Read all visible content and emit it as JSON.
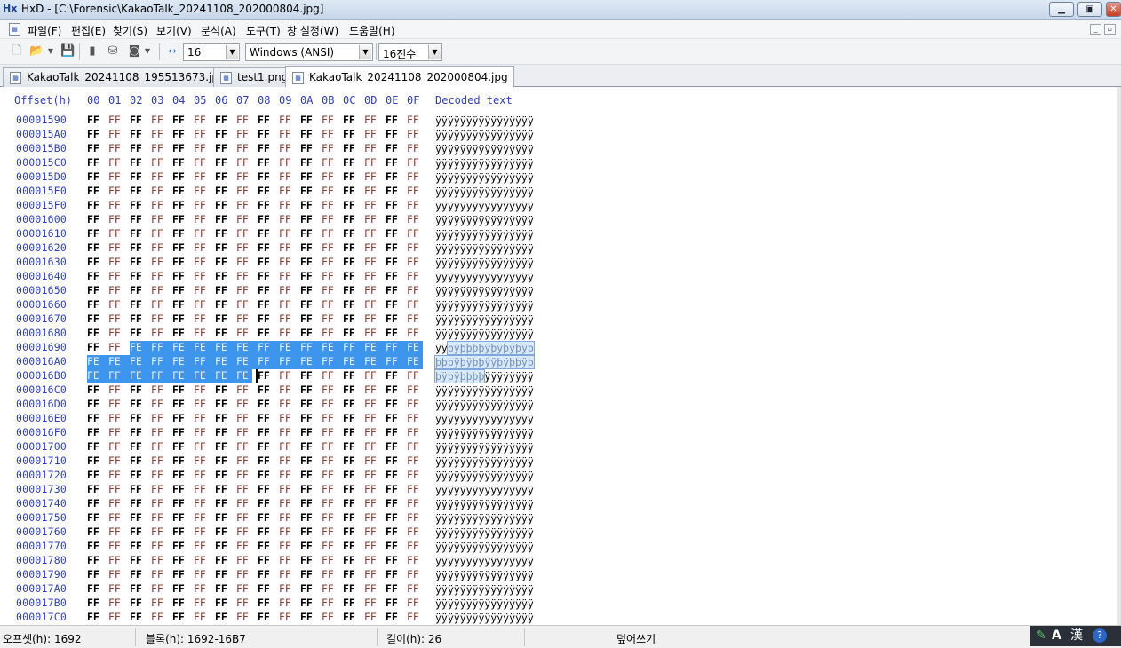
{
  "window": {
    "app_icon_text": "Hx",
    "title": "HxD - [C:\\Forensic\\KakaoTalk_20241108_202000804.jpg]",
    "min_label": "▁",
    "max_label": "▣",
    "close_label": "✕"
  },
  "menu": {
    "items": [
      "파일(F)",
      "편집(E)",
      "찾기(S)",
      "보기(V)",
      "분석(A)",
      "도구(T)",
      "창 설정(W)",
      "도움말(H)"
    ],
    "mdi_min": "_",
    "mdi_restore": "▫"
  },
  "toolbar": {
    "bytes_per_row": "16",
    "charset": "Windows (ANSI)",
    "offset_base": "16진수"
  },
  "tabs": [
    {
      "label": "KakaoTalk_20241108_195513673.jpg",
      "active": false
    },
    {
      "label": "test1.png",
      "active": false
    },
    {
      "label": "KakaoTalk_20241108_202000804.jpg",
      "active": true
    }
  ],
  "hex": {
    "offset_header": "Offset(h)",
    "columns": [
      "00",
      "01",
      "02",
      "03",
      "04",
      "05",
      "06",
      "07",
      "08",
      "09",
      "0A",
      "0B",
      "0C",
      "0D",
      "0E",
      "0F"
    ],
    "decoded_header": "Decoded text",
    "rows": [
      {
        "offset": "00001590",
        "bytes": [
          "FF",
          "FF",
          "FF",
          "FF",
          "FF",
          "FF",
          "FF",
          "FF",
          "FF",
          "FF",
          "FF",
          "FF",
          "FF",
          "FF",
          "FF",
          "FF"
        ],
        "text": "ÿÿÿÿÿÿÿÿÿÿÿÿÿÿÿÿ"
      },
      {
        "offset": "000015A0",
        "bytes": [
          "FF",
          "FF",
          "FF",
          "FF",
          "FF",
          "FF",
          "FF",
          "FF",
          "FF",
          "FF",
          "FF",
          "FF",
          "FF",
          "FF",
          "FF",
          "FF"
        ],
        "text": "ÿÿÿÿÿÿÿÿÿÿÿÿÿÿÿÿ"
      },
      {
        "offset": "000015B0",
        "bytes": [
          "FF",
          "FF",
          "FF",
          "FF",
          "FF",
          "FF",
          "FF",
          "FF",
          "FF",
          "FF",
          "FF",
          "FF",
          "FF",
          "FF",
          "FF",
          "FF"
        ],
        "text": "ÿÿÿÿÿÿÿÿÿÿÿÿÿÿÿÿ"
      },
      {
        "offset": "000015C0",
        "bytes": [
          "FF",
          "FF",
          "FF",
          "FF",
          "FF",
          "FF",
          "FF",
          "FF",
          "FF",
          "FF",
          "FF",
          "FF",
          "FF",
          "FF",
          "FF",
          "FF"
        ],
        "text": "ÿÿÿÿÿÿÿÿÿÿÿÿÿÿÿÿ"
      },
      {
        "offset": "000015D0",
        "bytes": [
          "FF",
          "FF",
          "FF",
          "FF",
          "FF",
          "FF",
          "FF",
          "FF",
          "FF",
          "FF",
          "FF",
          "FF",
          "FF",
          "FF",
          "FF",
          "FF"
        ],
        "text": "ÿÿÿÿÿÿÿÿÿÿÿÿÿÿÿÿ"
      },
      {
        "offset": "000015E0",
        "bytes": [
          "FF",
          "FF",
          "FF",
          "FF",
          "FF",
          "FF",
          "FF",
          "FF",
          "FF",
          "FF",
          "FF",
          "FF",
          "FF",
          "FF",
          "FF",
          "FF"
        ],
        "text": "ÿÿÿÿÿÿÿÿÿÿÿÿÿÿÿÿ"
      },
      {
        "offset": "000015F0",
        "bytes": [
          "FF",
          "FF",
          "FF",
          "FF",
          "FF",
          "FF",
          "FF",
          "FF",
          "FF",
          "FF",
          "FF",
          "FF",
          "FF",
          "FF",
          "FF",
          "FF"
        ],
        "text": "ÿÿÿÿÿÿÿÿÿÿÿÿÿÿÿÿ"
      },
      {
        "offset": "00001600",
        "bytes": [
          "FF",
          "FF",
          "FF",
          "FF",
          "FF",
          "FF",
          "FF",
          "FF",
          "FF",
          "FF",
          "FF",
          "FF",
          "FF",
          "FF",
          "FF",
          "FF"
        ],
        "text": "ÿÿÿÿÿÿÿÿÿÿÿÿÿÿÿÿ"
      },
      {
        "offset": "00001610",
        "bytes": [
          "FF",
          "FF",
          "FF",
          "FF",
          "FF",
          "FF",
          "FF",
          "FF",
          "FF",
          "FF",
          "FF",
          "FF",
          "FF",
          "FF",
          "FF",
          "FF"
        ],
        "text": "ÿÿÿÿÿÿÿÿÿÿÿÿÿÿÿÿ"
      },
      {
        "offset": "00001620",
        "bytes": [
          "FF",
          "FF",
          "FF",
          "FF",
          "FF",
          "FF",
          "FF",
          "FF",
          "FF",
          "FF",
          "FF",
          "FF",
          "FF",
          "FF",
          "FF",
          "FF"
        ],
        "text": "ÿÿÿÿÿÿÿÿÿÿÿÿÿÿÿÿ"
      },
      {
        "offset": "00001630",
        "bytes": [
          "FF",
          "FF",
          "FF",
          "FF",
          "FF",
          "FF",
          "FF",
          "FF",
          "FF",
          "FF",
          "FF",
          "FF",
          "FF",
          "FF",
          "FF",
          "FF"
        ],
        "text": "ÿÿÿÿÿÿÿÿÿÿÿÿÿÿÿÿ"
      },
      {
        "offset": "00001640",
        "bytes": [
          "FF",
          "FF",
          "FF",
          "FF",
          "FF",
          "FF",
          "FF",
          "FF",
          "FF",
          "FF",
          "FF",
          "FF",
          "FF",
          "FF",
          "FF",
          "FF"
        ],
        "text": "ÿÿÿÿÿÿÿÿÿÿÿÿÿÿÿÿ"
      },
      {
        "offset": "00001650",
        "bytes": [
          "FF",
          "FF",
          "FF",
          "FF",
          "FF",
          "FF",
          "FF",
          "FF",
          "FF",
          "FF",
          "FF",
          "FF",
          "FF",
          "FF",
          "FF",
          "FF"
        ],
        "text": "ÿÿÿÿÿÿÿÿÿÿÿÿÿÿÿÿ"
      },
      {
        "offset": "00001660",
        "bytes": [
          "FF",
          "FF",
          "FF",
          "FF",
          "FF",
          "FF",
          "FF",
          "FF",
          "FF",
          "FF",
          "FF",
          "FF",
          "FF",
          "FF",
          "FF",
          "FF"
        ],
        "text": "ÿÿÿÿÿÿÿÿÿÿÿÿÿÿÿÿ"
      },
      {
        "offset": "00001670",
        "bytes": [
          "FF",
          "FF",
          "FF",
          "FF",
          "FF",
          "FF",
          "FF",
          "FF",
          "FF",
          "FF",
          "FF",
          "FF",
          "FF",
          "FF",
          "FF",
          "FF"
        ],
        "text": "ÿÿÿÿÿÿÿÿÿÿÿÿÿÿÿÿ"
      },
      {
        "offset": "00001680",
        "bytes": [
          "FF",
          "FF",
          "FF",
          "FF",
          "FF",
          "FF",
          "FF",
          "FF",
          "FF",
          "FF",
          "FF",
          "FF",
          "FF",
          "FF",
          "FF",
          "FF"
        ],
        "text": "ÿÿÿÿÿÿÿÿÿÿÿÿÿÿÿÿ"
      },
      {
        "offset": "00001690",
        "bytes": [
          "FF",
          "FF",
          "FE",
          "FF",
          "FE",
          "FE",
          "FE",
          "FE",
          "FF",
          "FE",
          "FF",
          "FE",
          "FF",
          "FE",
          "FF",
          "FE"
        ],
        "text": "ÿÿþÿþþþþÿþÿþÿþÿþ"
      },
      {
        "offset": "000016A0",
        "bytes": [
          "FE",
          "FE",
          "FE",
          "FF",
          "FE",
          "FF",
          "FE",
          "FE",
          "FF",
          "FF",
          "FE",
          "FF",
          "FE",
          "FE",
          "FF",
          "FE"
        ],
        "text": "þþþÿþÿþþÿÿþÿþþÿþ"
      },
      {
        "offset": "000016B0",
        "bytes": [
          "FE",
          "FF",
          "FE",
          "FF",
          "FE",
          "FE",
          "FE",
          "FE",
          "FF",
          "FF",
          "FF",
          "FF",
          "FF",
          "FF",
          "FF",
          "FF"
        ],
        "text": "þÿþÿþþþþÿÿÿÿÿÿÿÿ"
      },
      {
        "offset": "000016C0",
        "bytes": [
          "FF",
          "FF",
          "FF",
          "FF",
          "FF",
          "FF",
          "FF",
          "FF",
          "FF",
          "FF",
          "FF",
          "FF",
          "FF",
          "FF",
          "FF",
          "FF"
        ],
        "text": "ÿÿÿÿÿÿÿÿÿÿÿÿÿÿÿÿ"
      },
      {
        "offset": "000016D0",
        "bytes": [
          "FF",
          "FF",
          "FF",
          "FF",
          "FF",
          "FF",
          "FF",
          "FF",
          "FF",
          "FF",
          "FF",
          "FF",
          "FF",
          "FF",
          "FF",
          "FF"
        ],
        "text": "ÿÿÿÿÿÿÿÿÿÿÿÿÿÿÿÿ"
      },
      {
        "offset": "000016E0",
        "bytes": [
          "FF",
          "FF",
          "FF",
          "FF",
          "FF",
          "FF",
          "FF",
          "FF",
          "FF",
          "FF",
          "FF",
          "FF",
          "FF",
          "FF",
          "FF",
          "FF"
        ],
        "text": "ÿÿÿÿÿÿÿÿÿÿÿÿÿÿÿÿ"
      },
      {
        "offset": "000016F0",
        "bytes": [
          "FF",
          "FF",
          "FF",
          "FF",
          "FF",
          "FF",
          "FF",
          "FF",
          "FF",
          "FF",
          "FF",
          "FF",
          "FF",
          "FF",
          "FF",
          "FF"
        ],
        "text": "ÿÿÿÿÿÿÿÿÿÿÿÿÿÿÿÿ"
      },
      {
        "offset": "00001700",
        "bytes": [
          "FF",
          "FF",
          "FF",
          "FF",
          "FF",
          "FF",
          "FF",
          "FF",
          "FF",
          "FF",
          "FF",
          "FF",
          "FF",
          "FF",
          "FF",
          "FF"
        ],
        "text": "ÿÿÿÿÿÿÿÿÿÿÿÿÿÿÿÿ"
      },
      {
        "offset": "00001710",
        "bytes": [
          "FF",
          "FF",
          "FF",
          "FF",
          "FF",
          "FF",
          "FF",
          "FF",
          "FF",
          "FF",
          "FF",
          "FF",
          "FF",
          "FF",
          "FF",
          "FF"
        ],
        "text": "ÿÿÿÿÿÿÿÿÿÿÿÿÿÿÿÿ"
      },
      {
        "offset": "00001720",
        "bytes": [
          "FF",
          "FF",
          "FF",
          "FF",
          "FF",
          "FF",
          "FF",
          "FF",
          "FF",
          "FF",
          "FF",
          "FF",
          "FF",
          "FF",
          "FF",
          "FF"
        ],
        "text": "ÿÿÿÿÿÿÿÿÿÿÿÿÿÿÿÿ"
      },
      {
        "offset": "00001730",
        "bytes": [
          "FF",
          "FF",
          "FF",
          "FF",
          "FF",
          "FF",
          "FF",
          "FF",
          "FF",
          "FF",
          "FF",
          "FF",
          "FF",
          "FF",
          "FF",
          "FF"
        ],
        "text": "ÿÿÿÿÿÿÿÿÿÿÿÿÿÿÿÿ"
      },
      {
        "offset": "00001740",
        "bytes": [
          "FF",
          "FF",
          "FF",
          "FF",
          "FF",
          "FF",
          "FF",
          "FF",
          "FF",
          "FF",
          "FF",
          "FF",
          "FF",
          "FF",
          "FF",
          "FF"
        ],
        "text": "ÿÿÿÿÿÿÿÿÿÿÿÿÿÿÿÿ"
      },
      {
        "offset": "00001750",
        "bytes": [
          "FF",
          "FF",
          "FF",
          "FF",
          "FF",
          "FF",
          "FF",
          "FF",
          "FF",
          "FF",
          "FF",
          "FF",
          "FF",
          "FF",
          "FF",
          "FF"
        ],
        "text": "ÿÿÿÿÿÿÿÿÿÿÿÿÿÿÿÿ"
      },
      {
        "offset": "00001760",
        "bytes": [
          "FF",
          "FF",
          "FF",
          "FF",
          "FF",
          "FF",
          "FF",
          "FF",
          "FF",
          "FF",
          "FF",
          "FF",
          "FF",
          "FF",
          "FF",
          "FF"
        ],
        "text": "ÿÿÿÿÿÿÿÿÿÿÿÿÿÿÿÿ"
      },
      {
        "offset": "00001770",
        "bytes": [
          "FF",
          "FF",
          "FF",
          "FF",
          "FF",
          "FF",
          "FF",
          "FF",
          "FF",
          "FF",
          "FF",
          "FF",
          "FF",
          "FF",
          "FF",
          "FF"
        ],
        "text": "ÿÿÿÿÿÿÿÿÿÿÿÿÿÿÿÿ"
      },
      {
        "offset": "00001780",
        "bytes": [
          "FF",
          "FF",
          "FF",
          "FF",
          "FF",
          "FF",
          "FF",
          "FF",
          "FF",
          "FF",
          "FF",
          "FF",
          "FF",
          "FF",
          "FF",
          "FF"
        ],
        "text": "ÿÿÿÿÿÿÿÿÿÿÿÿÿÿÿÿ"
      },
      {
        "offset": "00001790",
        "bytes": [
          "FF",
          "FF",
          "FF",
          "FF",
          "FF",
          "FF",
          "FF",
          "FF",
          "FF",
          "FF",
          "FF",
          "FF",
          "FF",
          "FF",
          "FF",
          "FF"
        ],
        "text": "ÿÿÿÿÿÿÿÿÿÿÿÿÿÿÿÿ"
      },
      {
        "offset": "000017A0",
        "bytes": [
          "FF",
          "FF",
          "FF",
          "FF",
          "FF",
          "FF",
          "FF",
          "FF",
          "FF",
          "FF",
          "FF",
          "FF",
          "FF",
          "FF",
          "FF",
          "FF"
        ],
        "text": "ÿÿÿÿÿÿÿÿÿÿÿÿÿÿÿÿ"
      },
      {
        "offset": "000017B0",
        "bytes": [
          "FF",
          "FF",
          "FF",
          "FF",
          "FF",
          "FF",
          "FF",
          "FF",
          "FF",
          "FF",
          "FF",
          "FF",
          "FF",
          "FF",
          "FF",
          "FF"
        ],
        "text": "ÿÿÿÿÿÿÿÿÿÿÿÿÿÿÿÿ"
      },
      {
        "offset": "000017C0",
        "bytes": [
          "FF",
          "FF",
          "FF",
          "FF",
          "FF",
          "FF",
          "FF",
          "FF",
          "FF",
          "FF",
          "FF",
          "FF",
          "FF",
          "FF",
          "FF",
          "FF"
        ],
        "text": "ÿÿÿÿÿÿÿÿÿÿÿÿÿÿÿÿ"
      }
    ]
  },
  "selection": {
    "start": "00001692",
    "end": "000016B7"
  },
  "status": {
    "offset": "오프셋(h): 1692",
    "block": "블록(h): 1692-16B7",
    "length": "길이(h): 26",
    "mode": "덮어쓰기"
  },
  "ime": {
    "mode1": "A",
    "mode2": "漢",
    "help": "?"
  },
  "colors": {
    "selection_bg": "#3d95ed",
    "offset_text": "#2e40b8",
    "odd_column_text": "#8c3a2e"
  }
}
